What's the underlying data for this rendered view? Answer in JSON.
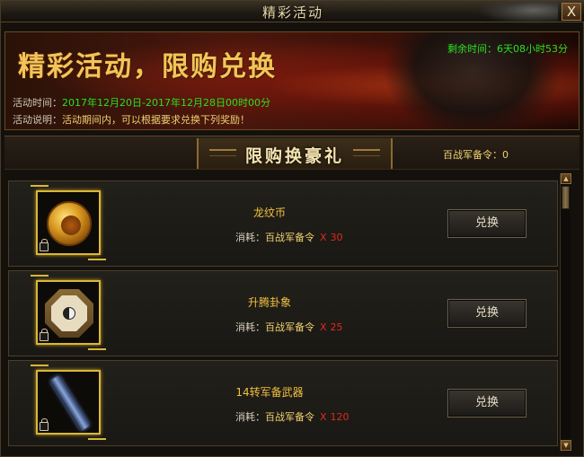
{
  "window": {
    "title": "精彩活动",
    "close_label": "X"
  },
  "banner": {
    "heading": "精彩活动，限购兑换",
    "countdown_label": "剩余时间：",
    "countdown_value": "6天08小时53分",
    "time_label": "活动时间：",
    "time_value": "2017年12月20日-2017年12月28日00时00分",
    "desc_label": "活动说明：",
    "desc_value": "活动期间内，可以根据要求兑换下列奖励！"
  },
  "section": {
    "title": "限购换豪礼",
    "token_label": "百战军备令：",
    "token_value": "0"
  },
  "items": [
    {
      "name": "龙纹币",
      "cost_label": "消耗：",
      "token_name": "百战军备令",
      "x": "X",
      "amount": "30",
      "button": "兑换",
      "icon": "dragon-coin-icon"
    },
    {
      "name": "升腾卦象",
      "cost_label": "消耗：",
      "token_name": "百战军备令",
      "x": "X",
      "amount": "25",
      "button": "兑换",
      "icon": "bagua-icon"
    },
    {
      "name": "14转军备武器",
      "cost_label": "消耗：",
      "token_name": "百战军备令",
      "x": "X",
      "amount": "120",
      "button": "兑换",
      "icon": "weapon-icon"
    }
  ],
  "scrollbar": {
    "up_glyph": "▲",
    "down_glyph": "▼"
  },
  "colors": {
    "gold": "#f0c040",
    "green": "#29e021",
    "red": "#e02a1a",
    "frame": "#d9b73a"
  }
}
